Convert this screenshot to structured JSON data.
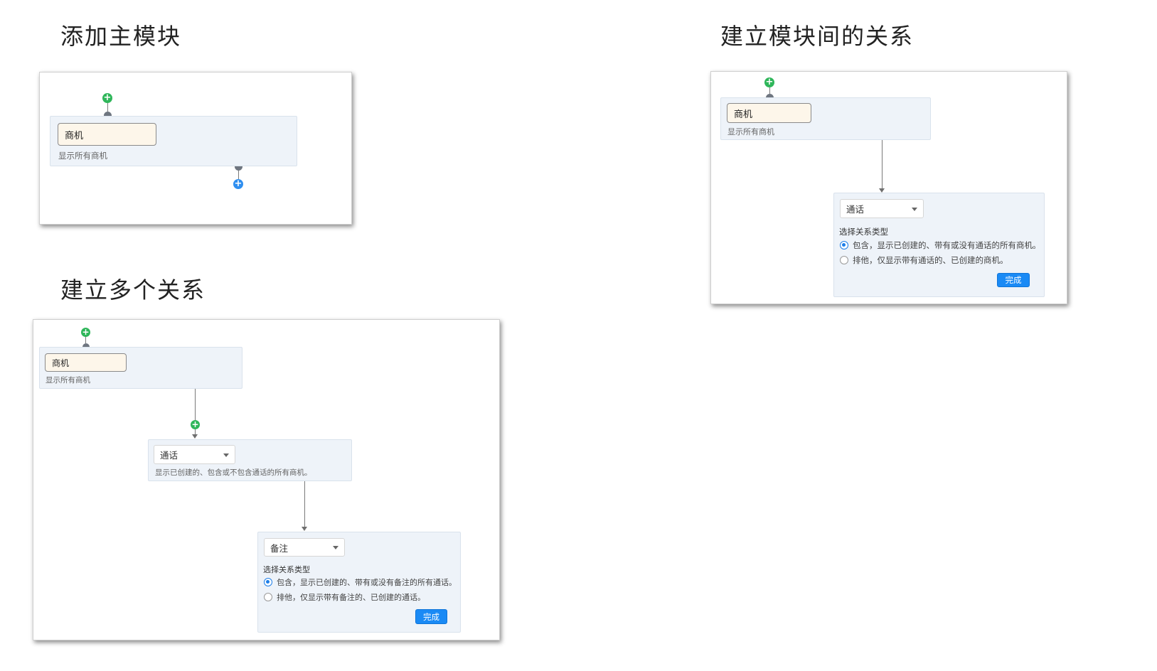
{
  "headings": {
    "add_main": "添加主模块",
    "build_relation": "建立模块间的关系",
    "multi_relation": "建立多个关系"
  },
  "module": {
    "name": "商机",
    "desc": "显示所有商机"
  },
  "calls": {
    "select_value": "通话",
    "desc": "显示已创建的、包含或不包含通话的所有商机。",
    "relation_title": "选择关系类型",
    "option_include": "包含，显示已创建的、带有或没有通话的所有商机。",
    "option_exclude": "排他，仅显示带有通话的、已创建的商机。",
    "done": "完成"
  },
  "notes": {
    "select_value": "备注",
    "relation_title": "选择关系类型",
    "option_include": "包含，显示已创建的、带有或没有备注的所有通话。",
    "option_exclude": "排他，仅显示带有备注的、已创建的通话。",
    "done": "完成"
  },
  "icons": {
    "add_green": "plus-circle-icon",
    "add_blue": "plus-circle-icon",
    "dropdown": "chevron-down-icon"
  },
  "colors": {
    "node_bg": "#eef3f9",
    "module_bg": "#fdf6ea",
    "primary": "#1a8af5",
    "add_green": "#2fb65a",
    "add_blue": "#2f8ff0"
  }
}
